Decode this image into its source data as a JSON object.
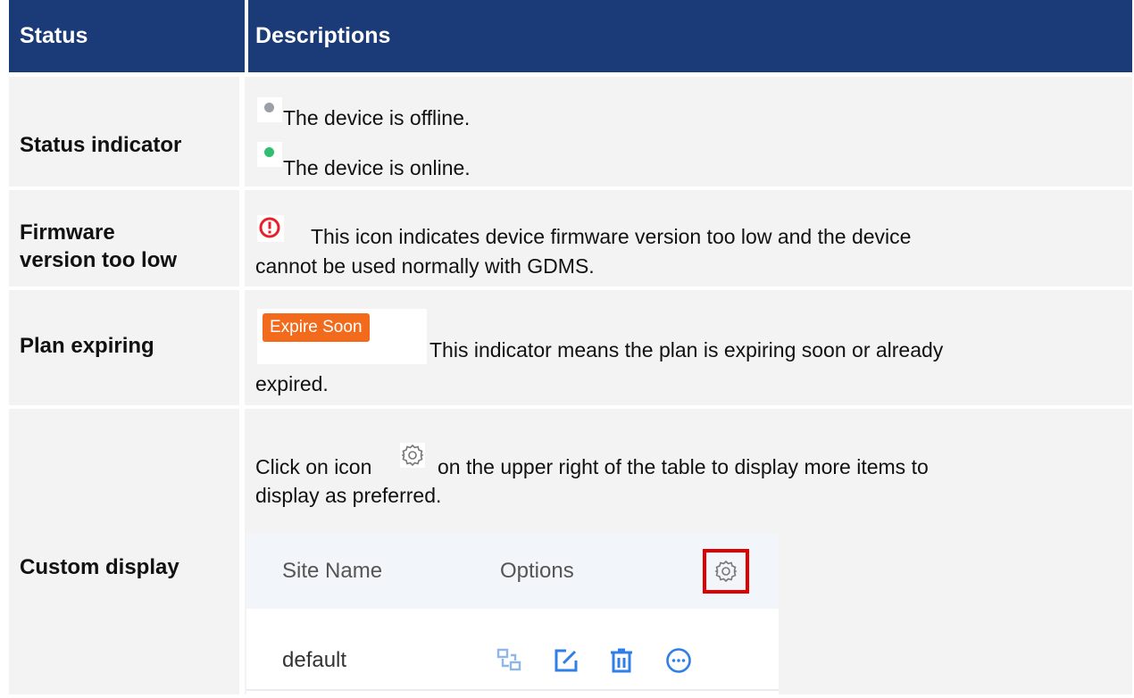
{
  "table": {
    "headers": {
      "status": "Status",
      "descriptions": "Descriptions"
    },
    "rows": [
      {
        "label": "Status indicator",
        "items": [
          {
            "icon": "gray-dot-icon",
            "color": "#9aa0a6",
            "text": "The device is offline."
          },
          {
            "icon": "green-dot-icon",
            "color": "#2fbf71",
            "text": "The device is online."
          }
        ]
      },
      {
        "label_line1": "Firmware",
        "label_line2": "version too low",
        "icon": "warning-circle-icon",
        "icon_color": "#e8202a",
        "text_line1": "This icon indicates device firmware version too low and the device",
        "text_line2": "cannot be used normally with GDMS."
      },
      {
        "label": "Plan expiring",
        "badge": "Expire Soon",
        "badge_color": "#f26b1d",
        "text_line1": "This indicator means the plan is expiring soon or already",
        "text_line2": "expired."
      },
      {
        "label": "Custom display",
        "text_line1_a": "Click on icon",
        "text_line1_b": "on the upper right of the table to display more items to",
        "text_line2": "display as preferred.",
        "mini_table": {
          "columns": [
            "Site Name",
            "Options"
          ],
          "row_name": "default",
          "icon_color": "#2f7fe8",
          "highlight_color": "#e00000"
        }
      }
    ]
  }
}
